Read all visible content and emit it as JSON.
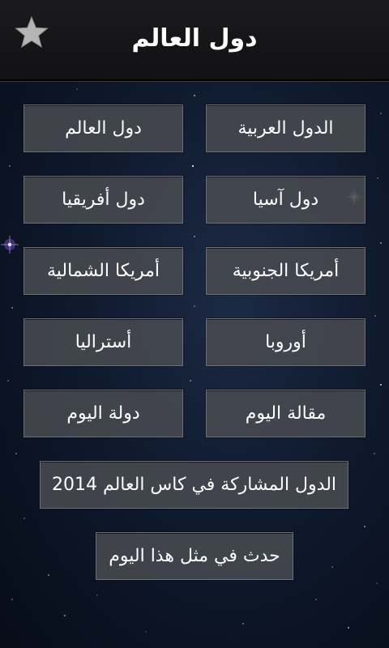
{
  "header": {
    "title": "دول العالم",
    "favorite_icon": "star-icon",
    "favorite_color": "#b5b5b5"
  },
  "grid": {
    "arab_countries": "الدول العربية",
    "world_countries": "دول العالم",
    "asia_countries": "دول آسيا",
    "africa_countries": "دول أفريقيا",
    "south_america": "أمريكا الجنوبية",
    "north_america": "أمريكا الشمالية",
    "europe": "أوروبا",
    "australia": "أستراليا",
    "article_of_day": "مقالة  اليوم",
    "country_of_day": "دولة  اليوم"
  },
  "world_cup_button": "الدول المشاركة في كاس العالم 2014",
  "on_this_day_button": "حدث في مثل هذا اليوم"
}
